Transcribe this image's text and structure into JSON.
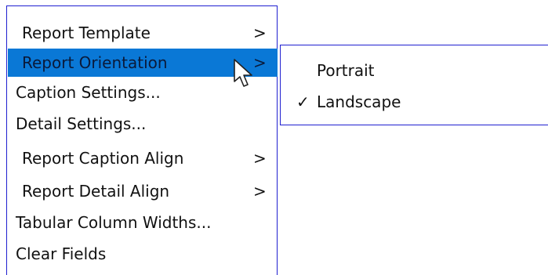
{
  "menu": {
    "items": [
      {
        "label": "Report Template",
        "arrow": ">",
        "highlighted": false
      },
      {
        "label": "Report Orientation",
        "arrow": ">",
        "highlighted": true
      },
      {
        "label": "Caption Settings...",
        "arrow": "",
        "highlighted": false
      },
      {
        "label": "Detail Settings...",
        "arrow": "",
        "highlighted": false
      },
      {
        "label": "Report Caption Align",
        "arrow": ">",
        "highlighted": false
      },
      {
        "label": "Report Detail Align",
        "arrow": ">",
        "highlighted": false
      },
      {
        "label": "Tabular Column Widths...",
        "arrow": "",
        "highlighted": false
      },
      {
        "label": "Clear Fields",
        "arrow": "",
        "highlighted": false
      }
    ]
  },
  "submenu": {
    "items": [
      {
        "label": "Portrait",
        "checked": false,
        "check_mark": ""
      },
      {
        "label": "Landscape",
        "checked": true,
        "check_mark": "✓"
      }
    ]
  },
  "colors": {
    "highlight": "#0a78d6",
    "border": "#1f1fd0",
    "text": "#111111"
  },
  "cursor_icon": "arrow-pointer-icon"
}
